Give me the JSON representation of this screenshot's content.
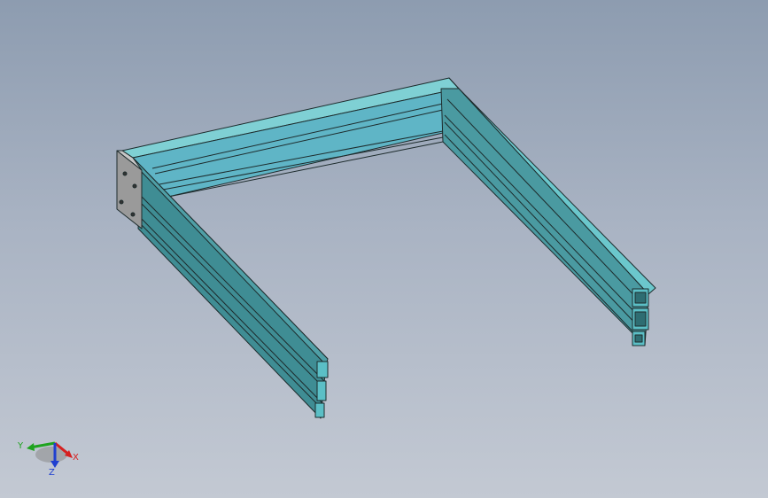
{
  "viewport": {
    "model": "aluminum-profile-u-frame"
  },
  "colors": {
    "background_top": "#8d9cb0",
    "background_bottom": "#c3c9d3",
    "profile_light": "#6bc7cc",
    "profile_mid": "#4fa6ad",
    "profile_dark": "#3a8289",
    "profile_inner": "#5eb2c4",
    "edge": "#1d2b2c",
    "plate": "#9a9a9a",
    "axis_x": "#d62020",
    "axis_y": "#1fa31f",
    "axis_z": "#2040d0"
  },
  "triad": {
    "x_label": "X",
    "y_label": "Y",
    "z_label": "Z"
  }
}
